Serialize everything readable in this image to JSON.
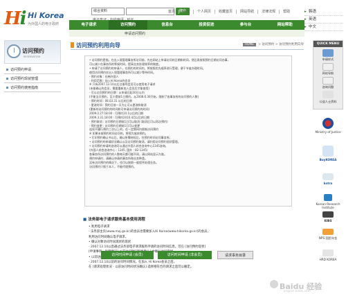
{
  "logo": {
    "mark_h": "H",
    "mark_i": "i",
    "name": "Hi Korea",
    "sub": "为外国人的电子政府"
  },
  "search": {
    "select_value": "综合资料",
    "button": "搜索",
    "links": "电子签证  · 在线申请  · 延长"
  },
  "top_links": [
    "首页",
    "进入",
    "个人网页",
    "收藏首页",
    "网站导航",
    "法律法规",
    "帮助"
  ],
  "lang": [
    "韩语",
    "英语",
    "中文"
  ],
  "nav": [
    "电子请求",
    "访问预约",
    "信息台",
    "投资促进",
    "参与台",
    "网站帮助"
  ],
  "subnav": "申请访问预约",
  "sidebar": {
    "title": "访问预约",
    "subtitle": "RESERVATION",
    "items": [
      "访问预约申请",
      "访问预约现状管理",
      "访问预约使用指南"
    ]
  },
  "content": {
    "title": "访问预约利用向导",
    "breadcrumb_home": "HOME",
    "breadcrumb": "> 访问预约 > 访问预约利用向导",
    "info_lines": [
      "• 访问预约是指，在出入境管理事务所访问前，先在网站上申请访问的日期和时间，然后再按照预约日期访问办事，",
      "  可以减少在事务所的等候时间，提高业务处理效率的制度。",
      "• 申请了访问预约的申请人，在预约的时间内，将按照优先顺序进行受理，便于节省办理时间。",
      "  使用访问预约在出入境管理事务所可以减少等待时间。",
      "  - 预约对象 : 在韩外国人",
      "  - 利用范围 : 加入Hi Korea的会员",
      "  ※ 只有2007.12.10以后注册的会员可以使用电子请求",
      "    (未能确认的会员，需要重新加入会员后才能使用)",
      "  - 可以访问预约的日期 : 从申请日起30日以内",
      "  (不能当天预约，至少提前1日预约。从2008.6.30开始，限制了各事务所的访问预约人数)",
      "  - 预约时间 : 08.03.31 以后的日期",
      "  - 更改时间 : 预约日前一天为止可以更改和取消",
      "  (更新的访问预约的时间和可申请访问预约的时间)",
      "    2009.2.27.18:00 : 可预约10.1以后的日期",
      "    2009.3.31.18:00 : 可预约2010.4月以后的日期",
      "  - 预约取消 : 访问预约日期前1日可以取消 (取消后可以再次预约)",
      "  - 预约变更 : 访问预约日期前1日可以变更",
      "    连续不履行预约三次以上的，在一定期间内限制访问预约",
      "  ※ 如果未按预约时间访问的，将视为放弃预约。",
      "• 打印预约确认书以后，确认所需材料后，在预约时间访问事务所。",
      "• 访问预约的申请状况确认以及访问预约取消，请利用访问预约现状管理。",
      "• 访问预约申请的咨询可以通过外国人综合咨询中心1345咨询。",
      "  (外国人综合咨询中心 : 1345, 国外 : 82-1345)",
      "  各事务所访问预约的人数每天都可能不同，请以网站显示为准。",
      "  预约申请时，请确认申请的事务所和业务种类。",
      "  没有访问预约的情况下，也可以按照一般程序处理业务。",
      "  访问预约只限于本人，不能代理预约。"
    ],
    "section_title": "法务部电子请求服务基本使用流程",
    "section_lines": [
      "• 利用电子请求",
      "  - 法务部主页(www.moj.go.kr)的会员也需要加入Hi Korea(www.hikorea.go.kr)的会员，",
      "    利用访问时间确认电子请求。",
      "• 确认对象访问时间现状的现状",
      "  - 2007.12.10以后通过法务部电子请求服务申请的访问时间信息，可在 [访问预约现状]",
      "    [申请事项 - 处理情况] 以前访问时间现状确认] 中确认访问现状。",
      "• 以前访问时间的确认",
      "  - 2007.12.10以前的访问时间情况，在加入 Hi Korea会员之后，",
      "    在 [请求处理状况 - 以前访问时间状况确认] 选择相符合的请求之后可以确定。"
    ],
    "btn_member": "访问时间申请 (会员)",
    "btn_nonmember": "访问时间申请 (非会员)",
    "btn_lookup": "请求事务目录"
  },
  "quick_menu": {
    "title": "QUICK MENU",
    "items": [
      "申请样式",
      "网站导航",
      "咨询问题",
      "公益人士资料"
    ]
  },
  "partners": [
    "Ministry of Justice",
    "BuyKOREA",
    "kotra",
    "Korean Research Institute",
    "KIBS",
    "NPS 国民年金",
    "HRD KOREA"
  ],
  "watermark": {
    "text": "Baidu 经验",
    "sub": "jingyan.baidu.com"
  },
  "colors": {
    "nav_green": "#3b8a2e",
    "title_blue": "#2b5a97",
    "accent_orange": "#e88f1f"
  }
}
